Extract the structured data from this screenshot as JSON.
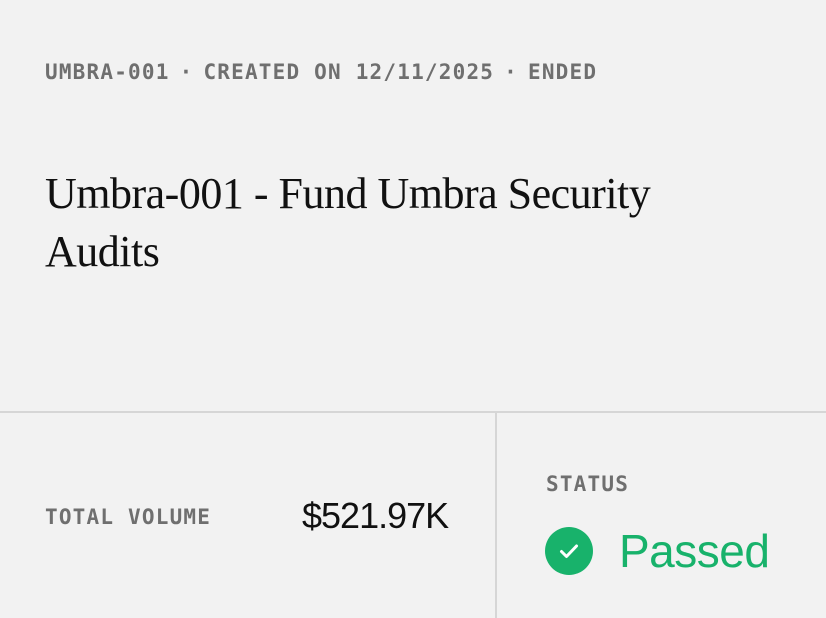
{
  "header": {
    "id": "UMBRA-001",
    "separator": "·",
    "created": "CREATED ON 12/11/2025",
    "state": "ENDED"
  },
  "proposal": {
    "title": "Umbra-001 - Fund Umbra Security Audits"
  },
  "stats": {
    "volume_label": "TOTAL VOLUME",
    "volume_value": "$521.97K",
    "status_label": "STATUS",
    "status_value": "Passed",
    "status_icon": "check-circle-icon",
    "status_color": "#18b26b"
  }
}
